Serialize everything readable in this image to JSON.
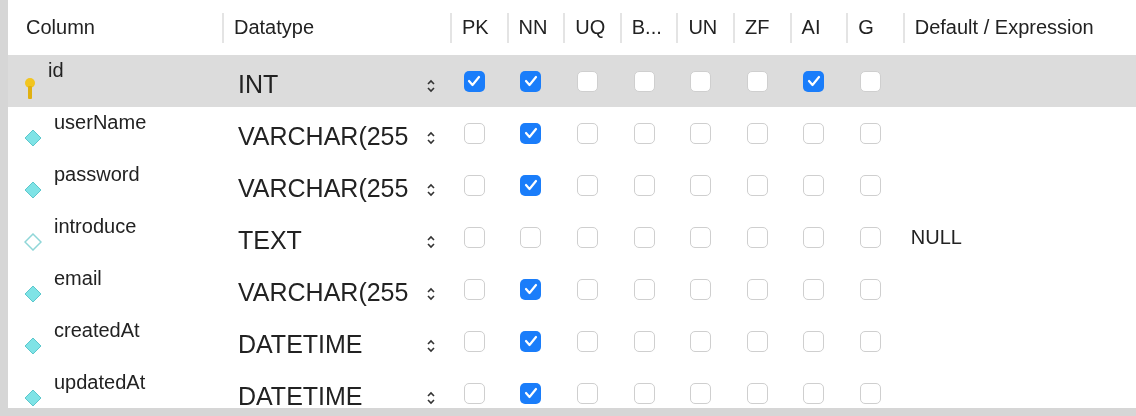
{
  "columns": [
    "Column",
    "Datatype",
    "PK",
    "NN",
    "UQ",
    "B...",
    "UN",
    "ZF",
    "AI",
    "G",
    "Default / Expression"
  ],
  "rows": [
    {
      "kind": "key",
      "name": "id",
      "datatype": "INT",
      "selected": true,
      "flags": [
        true,
        true,
        false,
        false,
        false,
        false,
        true,
        false
      ]
    },
    {
      "kind": "required",
      "name": "userName",
      "datatype": "VARCHAR(255",
      "selected": false,
      "flags": [
        false,
        true,
        false,
        false,
        false,
        false,
        false,
        false
      ]
    },
    {
      "kind": "required",
      "name": "password",
      "datatype": "VARCHAR(255",
      "selected": false,
      "flags": [
        false,
        true,
        false,
        false,
        false,
        false,
        false,
        false
      ]
    },
    {
      "kind": "nullable",
      "name": "introduce",
      "datatype": "TEXT",
      "selected": false,
      "flags": [
        false,
        false,
        false,
        false,
        false,
        false,
        false,
        false
      ],
      "default": "NULL"
    },
    {
      "kind": "required",
      "name": "email",
      "datatype": "VARCHAR(255",
      "selected": false,
      "flags": [
        false,
        true,
        false,
        false,
        false,
        false,
        false,
        false
      ]
    },
    {
      "kind": "required",
      "name": "createdAt",
      "datatype": "DATETIME",
      "selected": false,
      "flags": [
        false,
        true,
        false,
        false,
        false,
        false,
        false,
        false
      ]
    },
    {
      "kind": "required",
      "name": "updatedAt",
      "datatype": "DATETIME",
      "selected": false,
      "flags": [
        false,
        true,
        false,
        false,
        false,
        false,
        false,
        false
      ]
    }
  ]
}
